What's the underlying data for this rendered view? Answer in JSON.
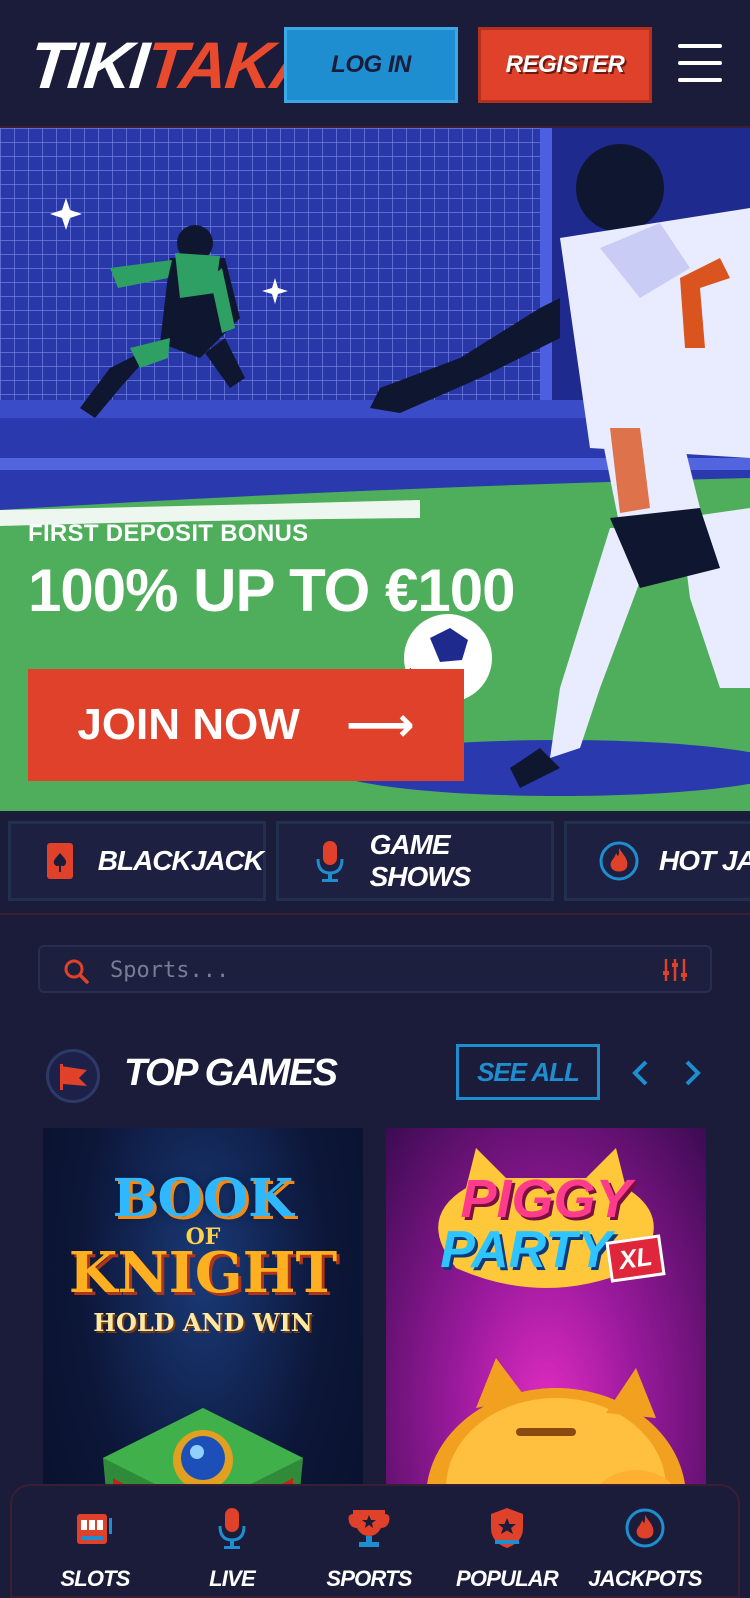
{
  "header": {
    "logo_part1": "TIKI",
    "logo_part2": "TAKA",
    "login_label": "LOG IN",
    "register_label": "REGISTER",
    "brand_colors": {
      "blue": "#1e8ed0",
      "red": "#e0412a",
      "bg": "#1a1c3a"
    }
  },
  "hero": {
    "subtitle": "FIRST DEPOSIT BONUS",
    "title": "100% UP TO €100",
    "cta_label": "JOIN NOW",
    "cta_arrow": "⟶"
  },
  "categories": [
    {
      "label": "BLACKJACK",
      "icon": "playing-card-icon"
    },
    {
      "label": "GAME SHOWS",
      "icon": "microphone-icon"
    },
    {
      "label": "HOT JA",
      "icon": "flame-icon"
    }
  ],
  "search": {
    "placeholder": "Sports..."
  },
  "top_games": {
    "title": "TOP GAMES",
    "see_all_label": "SEE ALL",
    "games": [
      {
        "line1": "BOOK",
        "line2": "OF",
        "line3": "KNIGHT",
        "line4": "HOLD AND WIN"
      },
      {
        "line1": "PIGGY",
        "line2": "PARTY",
        "badge": "XL"
      }
    ]
  },
  "bottom_nav": [
    {
      "label": "SLOTS",
      "icon": "slot-machine-icon"
    },
    {
      "label": "LIVE",
      "icon": "microphone-icon"
    },
    {
      "label": "SPORTS",
      "icon": "trophy-icon"
    },
    {
      "label": "POPULAR",
      "icon": "star-shield-icon"
    },
    {
      "label": "JACKPOTS",
      "icon": "flame-icon"
    }
  ]
}
